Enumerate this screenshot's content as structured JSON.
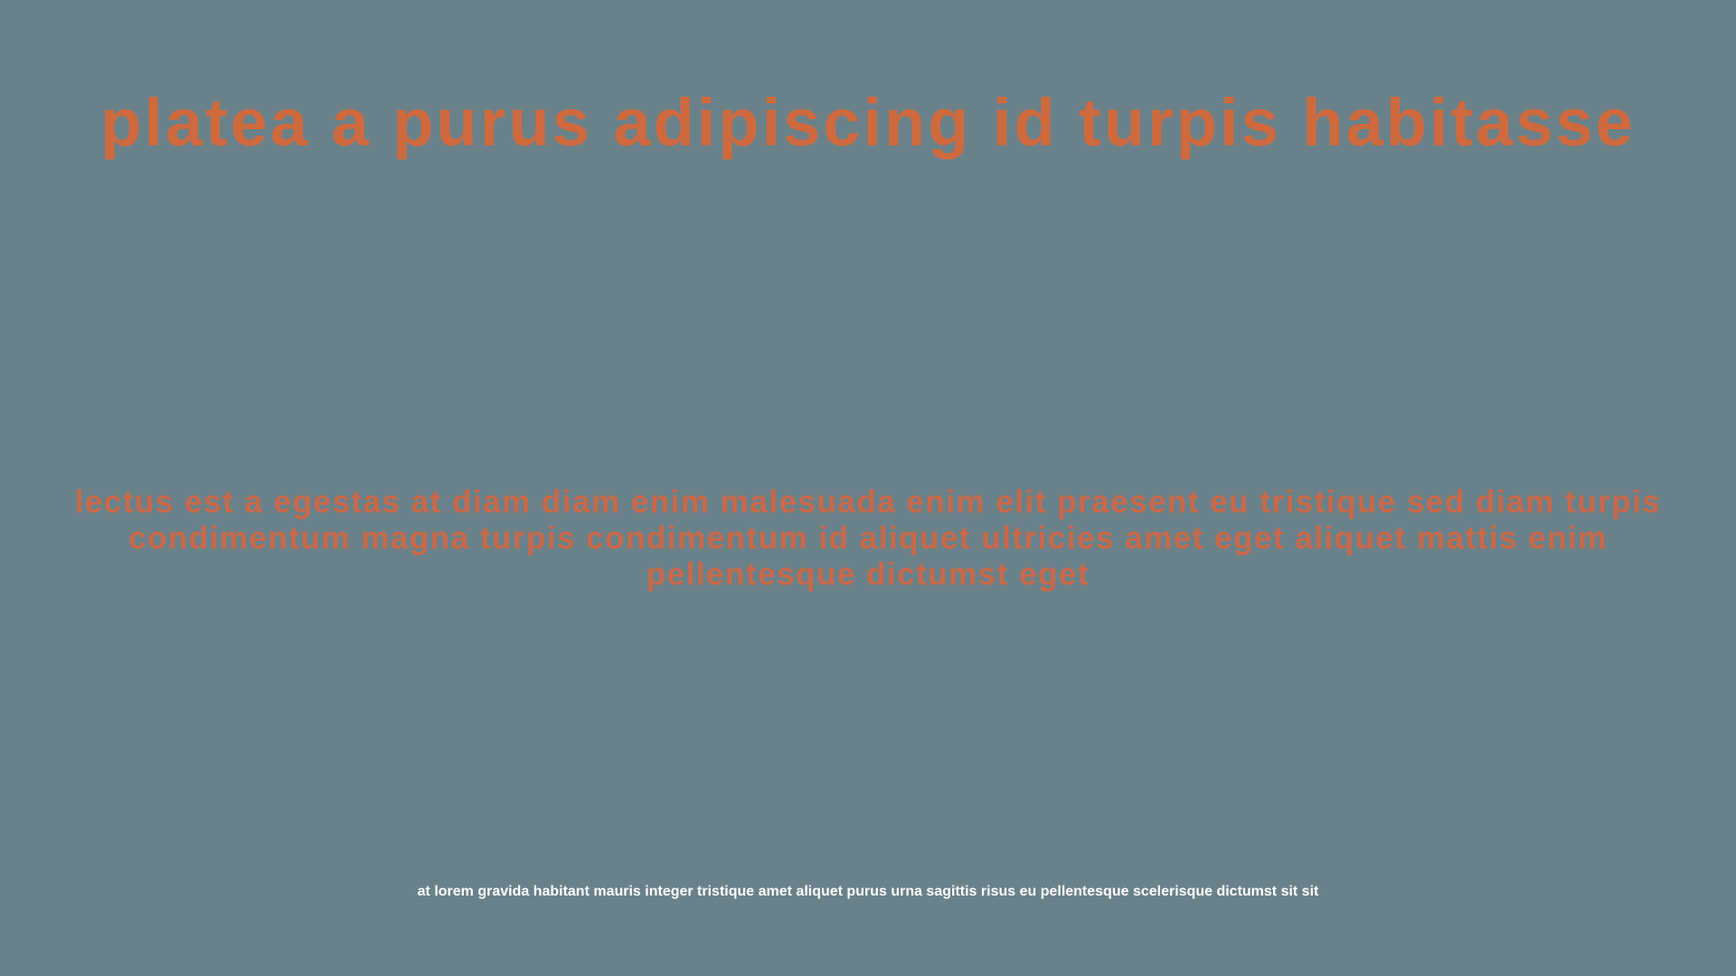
{
  "slide": {
    "title": "platea a purus adipiscing id turpis habitasse",
    "body": "lectus est a egestas at diam diam enim malesuada enim elit praesent eu tristique sed diam turpis condimentum magna turpis condimentum id aliquet ultricies amet eget aliquet mattis enim pellentesque dictumst eget",
    "footer": "at lorem gravida habitant mauris integer tristique amet aliquet purus urna sagittis risus eu pellentesque scelerisque dictumst sit sit"
  },
  "colors": {
    "background": "#6a8189",
    "title": "#cf6a3f",
    "body": "#c9694a",
    "footer": "#ffffff"
  }
}
